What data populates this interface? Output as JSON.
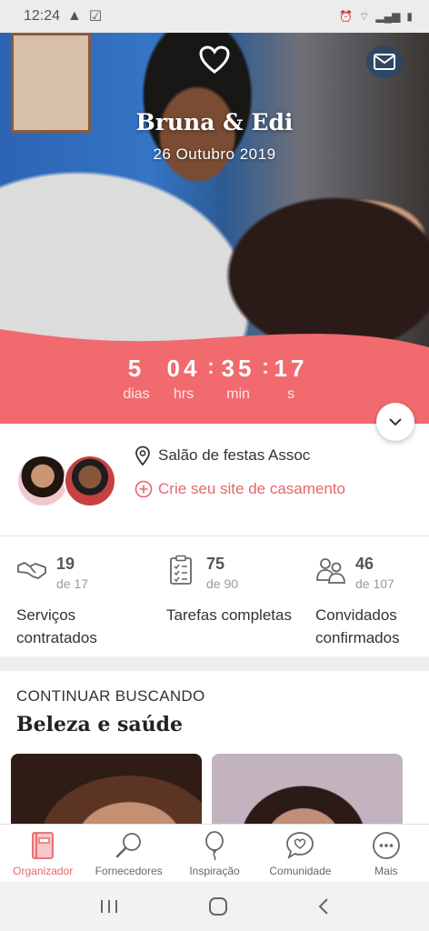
{
  "status_bar": {
    "time": "12:24"
  },
  "hero": {
    "couple_names": "Bruna & Edi",
    "wedding_date": "26 Outubro 2019"
  },
  "countdown": {
    "days": "5",
    "hours": "04",
    "minutes": "35",
    "seconds": "17",
    "days_label": "dias",
    "hours_label": "hrs",
    "minutes_label": "min",
    "seconds_label": "s",
    "separator": ":"
  },
  "profile": {
    "venue": "Salão de festas Assoc",
    "create_site_label": "Crie seu site de casamento"
  },
  "stats": [
    {
      "icon": "handshake-icon",
      "value": "19",
      "total": "de 17",
      "label": "Serviços contratados"
    },
    {
      "icon": "clipboard-checklist-icon",
      "value": "75",
      "total": "de 90",
      "label": "Tarefas completas"
    },
    {
      "icon": "guests-icon",
      "value": "46",
      "total": "de 107",
      "label": "Convidados confirmados"
    }
  ],
  "continue": {
    "overline": "CONTINUAR BUSCANDO",
    "title": "Beleza e saúde"
  },
  "bottom_nav": [
    {
      "icon": "organizer-notebook-icon",
      "label": "Organizador",
      "active": true
    },
    {
      "icon": "magnifier-icon",
      "label": "Fornecedores",
      "active": false
    },
    {
      "icon": "balloon-icon",
      "label": "Inspiração",
      "active": false
    },
    {
      "icon": "chat-heart-icon",
      "label": "Comunidade",
      "active": false
    },
    {
      "icon": "more-dots-icon",
      "label": "Mais",
      "active": false
    }
  ],
  "colors": {
    "accent": "#F06A6E",
    "accent_text": "#E6666B",
    "gap_gray": "#EEEEEE"
  }
}
